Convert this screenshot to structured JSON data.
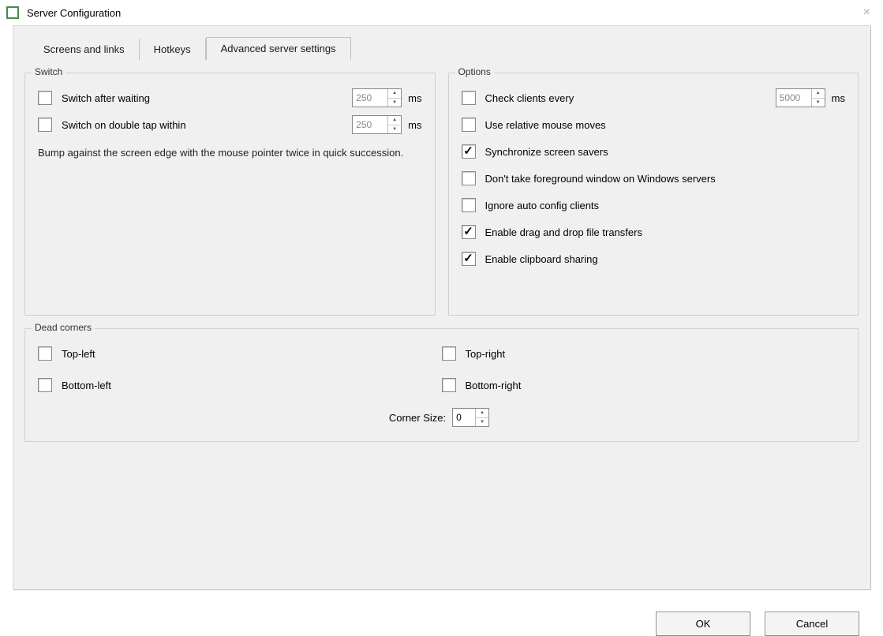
{
  "window": {
    "title": "Server Configuration"
  },
  "tabs": {
    "items": [
      {
        "label": "Screens and links",
        "active": false
      },
      {
        "label": "Hotkeys",
        "active": false
      },
      {
        "label": "Advanced server settings",
        "active": true
      }
    ]
  },
  "switch": {
    "title": "Switch",
    "after_waiting": {
      "label": "Switch after waiting",
      "checked": false,
      "value": "250",
      "unit": "ms"
    },
    "double_tap": {
      "label": "Switch on double tap within",
      "checked": false,
      "value": "250",
      "unit": "ms"
    },
    "hint": "Bump against the screen edge with the mouse pointer twice in quick succession."
  },
  "options": {
    "title": "Options",
    "check_clients": {
      "label": "Check clients every",
      "checked": false,
      "value": "5000",
      "unit": "ms"
    },
    "items": [
      {
        "key": "relative_mouse",
        "label": "Use relative mouse moves",
        "checked": false
      },
      {
        "key": "sync_savers",
        "label": "Synchronize screen savers",
        "checked": true
      },
      {
        "key": "no_foreground",
        "label": "Don't take foreground window on Windows servers",
        "checked": false
      },
      {
        "key": "ignore_autoconf",
        "label": "Ignore auto config clients",
        "checked": false
      },
      {
        "key": "drag_drop",
        "label": "Enable drag and drop file transfers",
        "checked": true
      },
      {
        "key": "clipboard",
        "label": "Enable clipboard sharing",
        "checked": true
      }
    ]
  },
  "dead_corners": {
    "title": "Dead corners",
    "top_left": {
      "label": "Top-left",
      "checked": false
    },
    "top_right": {
      "label": "Top-right",
      "checked": false
    },
    "bottom_left": {
      "label": "Bottom-left",
      "checked": false
    },
    "bottom_right": {
      "label": "Bottom-right",
      "checked": false
    },
    "corner_size": {
      "label": "Corner Size:",
      "value": "0"
    }
  },
  "buttons": {
    "ok": "OK",
    "cancel": "Cancel"
  }
}
